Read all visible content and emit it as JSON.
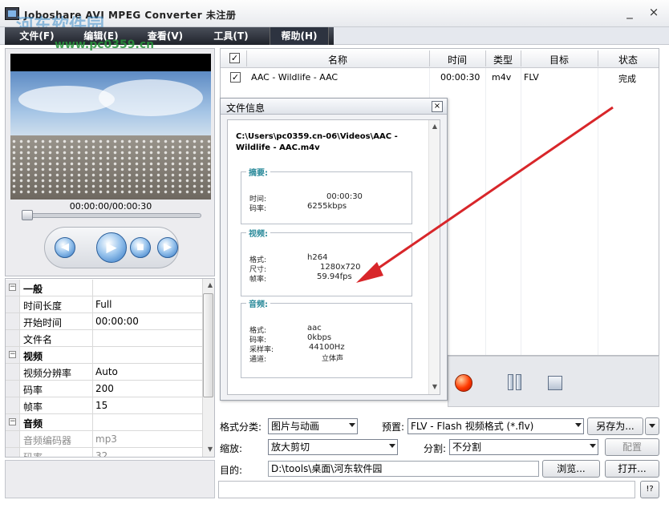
{
  "window": {
    "title": "Joboshare AVI MPEG Converter 未注册",
    "min_glyph": "_",
    "close_glyph": "×"
  },
  "watermark": {
    "site": "河东软件园",
    "url": "www.pc0359.cn"
  },
  "menu": [
    {
      "label": "文件(F)"
    },
    {
      "label": "编辑(E)"
    },
    {
      "label": "查看(V)"
    },
    {
      "label": "工具(T)"
    },
    {
      "label": "帮助(H)"
    }
  ],
  "player": {
    "time": "00:00:00/00:00:30",
    "progress": 0.0,
    "prev_glyph": "◀",
    "play_glyph": "▶",
    "stop_glyph": "■",
    "next_glyph": "▶"
  },
  "properties": [
    {
      "name": "一般",
      "value": "",
      "group": true,
      "toggle": "−"
    },
    {
      "name": "时间长度",
      "value": "Full"
    },
    {
      "name": "开始时间",
      "value": "00:00:00"
    },
    {
      "name": "文件名",
      "value": ""
    },
    {
      "name": "视频",
      "value": "",
      "group": true,
      "toggle": "−"
    },
    {
      "name": "视频分辨率",
      "value": "Auto"
    },
    {
      "name": "码率",
      "value": "200"
    },
    {
      "name": "帧率",
      "value": "15"
    },
    {
      "name": "音频",
      "value": "",
      "group": true,
      "toggle": "−"
    },
    {
      "name": "音频编码器",
      "value": "mp3",
      "gray": true
    },
    {
      "name": "码率",
      "value": "32",
      "gray": true
    }
  ],
  "file_list": {
    "headers": {
      "name": "名称",
      "time": "时间",
      "type": "类型",
      "target": "目标",
      "status": "状态"
    },
    "header_checked": "✓",
    "rows": [
      {
        "checked": "✓",
        "name": "AAC - Wildlife - AAC",
        "time": "00:00:30",
        "type": "m4v",
        "target": "FLV",
        "status": "完成"
      }
    ]
  },
  "file_info": {
    "title": "文件信息",
    "close_glyph": "×",
    "path": "C:\\Users\\pc0359.cn-06\\Videos\\AAC - Wildlife - AAC.m4v",
    "summary": {
      "title": "摘要:",
      "duration_label": "时间:",
      "duration": "00:00:30",
      "bitrate_label": "码率:",
      "bitrate": "6255kbps"
    },
    "video": {
      "title": "视频:",
      "format_label": "格式:",
      "format": "h264",
      "size_label": "尺寸:",
      "size": "1280x720",
      "fps_label": "帧率:",
      "fps": "59.94fps"
    },
    "audio": {
      "title": "音频:",
      "format_label": "格式:",
      "format": "aac",
      "bitrate_label": "码率:",
      "bitrate": "0kbps",
      "sample_label": "采样率:",
      "sample": "44100Hz",
      "channel_label": "通道:",
      "channel": "立体声"
    }
  },
  "form": {
    "category_label": "格式分类:",
    "category_value": "图片与动画",
    "preset_label": "预置:",
    "preset_value": "FLV - Flash 视频格式 (*.flv)",
    "save_as": "另存为...",
    "zoom_label": "缩放:",
    "zoom_value": "放大剪切",
    "split_label": "分割:",
    "split_value": "不分割",
    "config": "配置",
    "dest_label": "目的:",
    "dest_value": "D:\\tools\\桌面\\河东软件园",
    "browse": "浏览...",
    "open": "打开...",
    "help": "!?"
  },
  "colors": {
    "menu_bg": "#1f232b",
    "accent": "#2e74c2",
    "arrow": "#d8262a"
  }
}
